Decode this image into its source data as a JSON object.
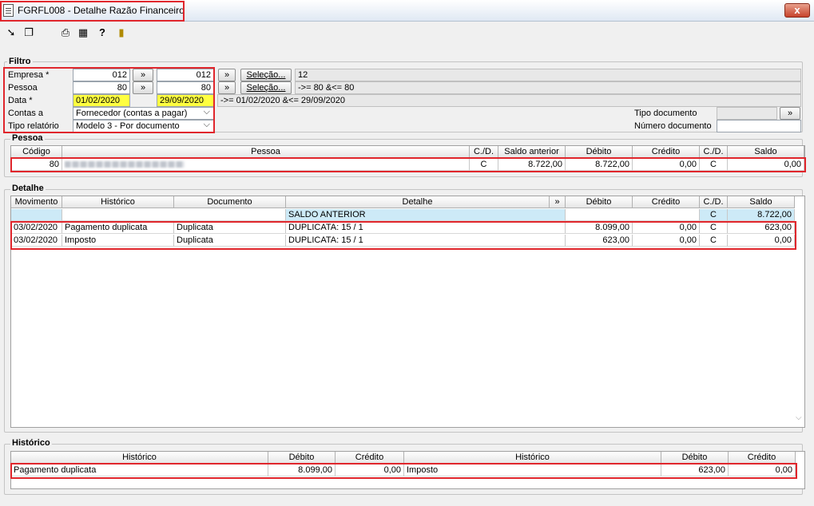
{
  "window": {
    "title": "FGRFL008 - Detalhe Razão Financeiro",
    "close": "x"
  },
  "toolbar": {
    "icons": [
      "arrow-in-icon",
      "copy-icon",
      "print-icon",
      "grid-icon",
      "help-icon",
      "exit-door-icon"
    ]
  },
  "filtro": {
    "title": "Filtro",
    "empresa": {
      "label": "Empresa *",
      "from": "012",
      "to": "012",
      "selecao_label": "Seleção...",
      "summary": "12"
    },
    "pessoa": {
      "label": "Pessoa",
      "from": "80",
      "to": "80",
      "selecao_label": "Seleção...",
      "summary": "->= 80  &<= 80"
    },
    "data": {
      "label": "Data *",
      "from": "01/02/2020",
      "to": "29/09/2020",
      "summary": "->= 01/02/2020  &<= 29/09/2020"
    },
    "contas_a": {
      "label": "Contas a",
      "value": "Fornecedor (contas a pagar)"
    },
    "tipo_relatorio": {
      "label": "Tipo relatório",
      "value": "Modelo 3 - Por documento"
    },
    "tipo_documento": {
      "label": "Tipo documento",
      "value": ""
    },
    "numero_documento": {
      "label": "Número documento",
      "value": ""
    },
    "arrow": "»"
  },
  "pessoa": {
    "title": "Pessoa",
    "columns": [
      "Código",
      "Pessoa",
      "C./D.",
      "Saldo anterior",
      "Débito",
      "Crédito",
      "C./D.",
      "Saldo"
    ],
    "row": {
      "codigo": "80",
      "cd1": "C",
      "saldo_anterior": "8.722,00",
      "debito": "8.722,00",
      "credito": "0,00",
      "cd2": "C",
      "saldo": "0,00"
    }
  },
  "detalhe": {
    "title": "Detalhe",
    "columns": [
      "Movimento",
      "Histórico",
      "Documento",
      "Detalhe",
      "»",
      "Débito",
      "Crédito",
      "C./D.",
      "Saldo"
    ],
    "saldo_anterior": {
      "detalhe": "SALDO ANTERIOR",
      "cd": "C",
      "saldo": "8.722,00"
    },
    "rows": [
      {
        "movimento": "03/02/2020",
        "historico": "Pagamento duplicata",
        "documento": "Duplicata",
        "detalhe": "DUPLICATA: 15 / 1",
        "debito": "8.099,00",
        "credito": "0,00",
        "cd": "C",
        "saldo": "623,00"
      },
      {
        "movimento": "03/02/2020",
        "historico": "Imposto",
        "documento": "Duplicata",
        "detalhe": "DUPLICATA: 15 / 1",
        "debito": "623,00",
        "credito": "0,00",
        "cd": "C",
        "saldo": "0,00"
      }
    ]
  },
  "historico": {
    "title": "Histórico",
    "columns": [
      "Histórico",
      "Débito",
      "Crédito",
      "Histórico",
      "Débito",
      "Crédito"
    ],
    "left": {
      "historico": "Pagamento duplicata",
      "debito": "8.099,00",
      "credito": "0,00"
    },
    "right": {
      "historico": "Imposto",
      "debito": "623,00",
      "credito": "0,00"
    }
  }
}
